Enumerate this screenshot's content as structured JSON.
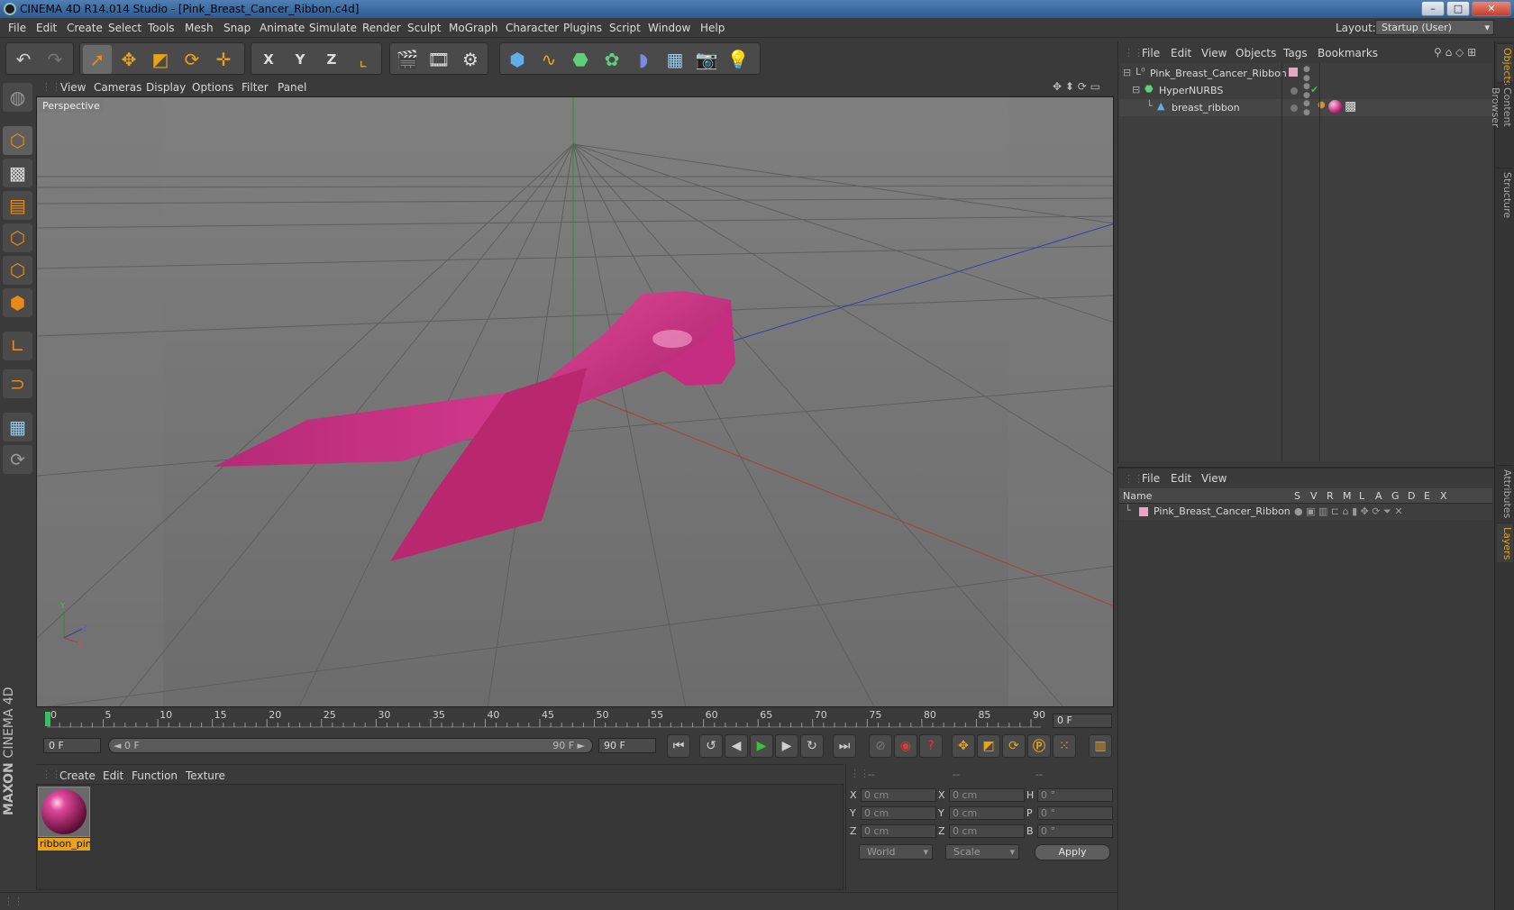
{
  "window": {
    "title": "CINEMA 4D R14.014 Studio - [Pink_Breast_Cancer_Ribbon.c4d]",
    "buttons": [
      "–",
      "□",
      "✕"
    ]
  },
  "menubar": {
    "items": [
      "File",
      "Edit",
      "Create",
      "Select",
      "Tools",
      "Mesh",
      "Snap",
      "Animate",
      "Simulate",
      "Render",
      "Sculpt",
      "MoGraph",
      "Character",
      "Plugins",
      "Script",
      "Window",
      "Help"
    ],
    "layout_label": "Layout:",
    "layout_value": "Startup (User)"
  },
  "toolbar": {
    "icons": [
      "undo-icon",
      "redo-icon",
      "live-selection-icon",
      "move-icon",
      "scale-icon",
      "rotate-icon",
      "add-icon",
      "x-axis-icon",
      "y-axis-icon",
      "z-axis-icon",
      "coordinate-system-icon",
      "render-view-icon",
      "render-picture-viewer-icon",
      "edit-render-settings-icon",
      "cube-icon",
      "spline-pen-icon",
      "subdivision-surface-icon",
      "array-icon",
      "deformer-icon",
      "floor-icon",
      "camera-icon",
      "light-icon"
    ],
    "axis_letters": [
      "X",
      "Y",
      "Z"
    ]
  },
  "viewport": {
    "menu": [
      "View",
      "Cameras",
      "Display",
      "Options",
      "Filter",
      "Panel"
    ],
    "label": "Perspective",
    "colors": {
      "background": "#8a8a8a",
      "ribbon": "#d6308a",
      "x_axis": "#b33a3a",
      "y_axis": "#2c8a2c",
      "z_axis": "#3a3ab3"
    },
    "axis_letters": {
      "y": "Y",
      "z": "Z",
      "x": "X"
    }
  },
  "timeline": {
    "ticks": [
      "0",
      "5",
      "10",
      "15",
      "20",
      "25",
      "30",
      "35",
      "40",
      "45",
      "50",
      "55",
      "60",
      "65",
      "70",
      "75",
      "80",
      "85",
      "90"
    ],
    "current_frame": "0 F"
  },
  "playback": {
    "start": "0 F",
    "range_start": "◄ 0 F",
    "range_end": "90 F ►",
    "end": "90 F"
  },
  "materials": {
    "menu": [
      "Create",
      "Edit",
      "Function",
      "Texture"
    ],
    "items": [
      {
        "name": "ribbon_pin"
      }
    ]
  },
  "coordinates": {
    "headers": [
      "--",
      "--",
      "--"
    ],
    "rows": [
      {
        "l1": "X",
        "v1": "0 cm",
        "l2": "X",
        "v2": "0 cm",
        "l3": "H",
        "v3": "0 °"
      },
      {
        "l1": "Y",
        "v1": "0 cm",
        "l2": "Y",
        "v2": "0 cm",
        "l3": "P",
        "v3": "0 °"
      },
      {
        "l1": "Z",
        "v1": "0 cm",
        "l2": "Z",
        "v2": "0 cm",
        "l3": "B",
        "v3": "0 °"
      }
    ],
    "world": "World",
    "scale": "Scale",
    "apply": "Apply"
  },
  "objects_panel": {
    "menu": [
      "File",
      "Edit",
      "View",
      "Objects",
      "Tags",
      "Bookmarks"
    ],
    "tree": [
      {
        "name": "Pink_Breast_Cancer_Ribbon"
      },
      {
        "name": "HyperNURBS"
      },
      {
        "name": "breast_ribbon"
      }
    ]
  },
  "layers_panel": {
    "menu": [
      "File",
      "Edit",
      "View"
    ],
    "columns": [
      "Name",
      "S",
      "V",
      "R",
      "M",
      "L",
      "A",
      "G",
      "D",
      "E",
      "X"
    ],
    "rows": [
      {
        "name": "Pink_Breast_Cancer_Ribbon"
      }
    ]
  },
  "side_tabs": [
    "Objects",
    "Content Browser",
    "Structure",
    "Attributes",
    "Layers"
  ],
  "logo": {
    "text1": "MAXON",
    "text2": "CINEMA 4D"
  }
}
